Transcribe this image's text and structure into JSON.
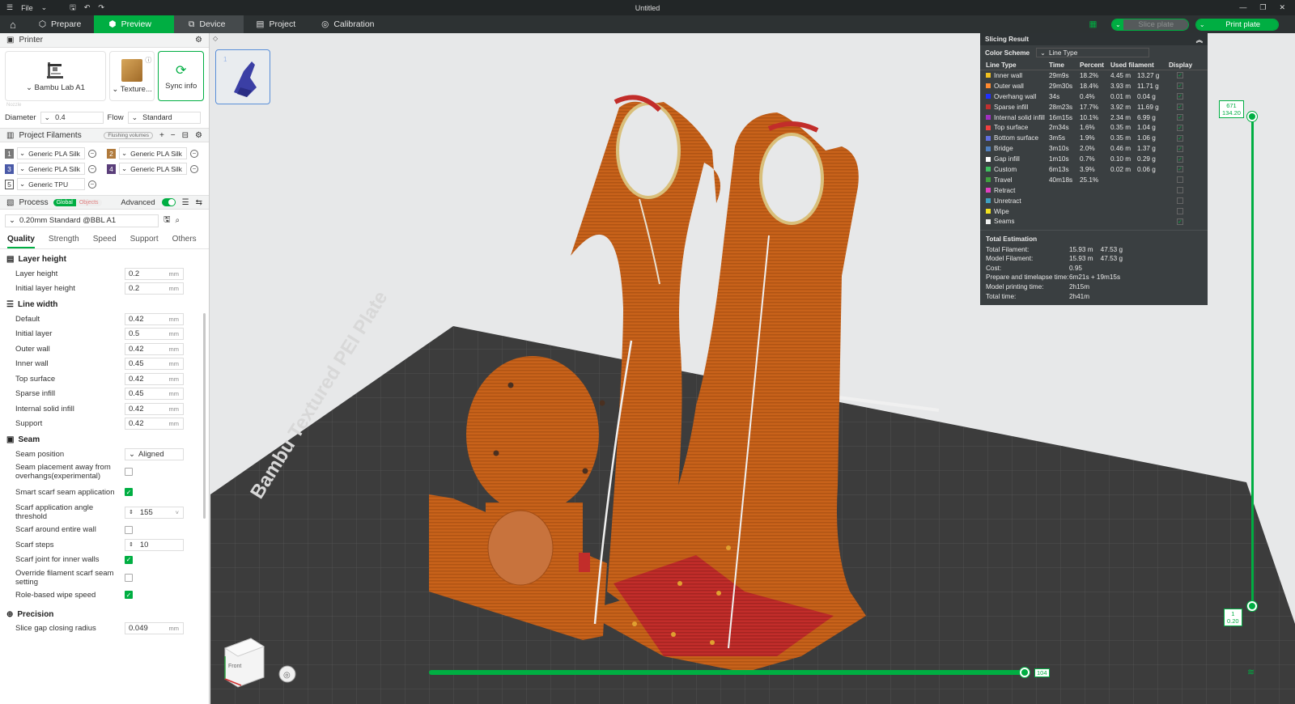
{
  "titlebar": {
    "file": "File",
    "title": "Untitled"
  },
  "tabs": {
    "prepare": "Prepare",
    "preview": "Preview",
    "device": "Device",
    "project": "Project",
    "calibration": "Calibration"
  },
  "actions": {
    "slice": "Slice plate",
    "print": "Print plate"
  },
  "printer": {
    "section": "Printer",
    "model": "Bambu Lab A1",
    "plate": "Texture...",
    "sync": "Sync info",
    "nozzle": "Nozzle",
    "diameter_label": "Diameter",
    "diameter": "0.4",
    "flow_label": "Flow",
    "flow": "Standard"
  },
  "filaments": {
    "section": "Project Filaments",
    "flushing": "Flushing volumes",
    "items": [
      {
        "num": "1",
        "name": "Generic PLA Silk",
        "color": "#7a7a7a"
      },
      {
        "num": "2",
        "name": "Generic PLA Silk",
        "color": "#b07a3c"
      },
      {
        "num": "3",
        "name": "Generic PLA Silk",
        "color": "#4a5aa8"
      },
      {
        "num": "4",
        "name": "Generic PLA Silk",
        "color": "#5a3e7a"
      },
      {
        "num": "5",
        "name": "Generic TPU",
        "color": "#ffffff"
      }
    ]
  },
  "process": {
    "section": "Process",
    "global": "Global",
    "objects": "Objects",
    "advanced": "Advanced",
    "preset": "0.20mm Standard @BBL A1",
    "tabs": [
      "Quality",
      "Strength",
      "Speed",
      "Support",
      "Others"
    ]
  },
  "params": {
    "layer_height": {
      "title": "Layer height",
      "rows": [
        {
          "label": "Layer height",
          "value": "0.2",
          "unit": "mm"
        },
        {
          "label": "Initial layer height",
          "value": "0.2",
          "unit": "mm"
        }
      ]
    },
    "line_width": {
      "title": "Line width",
      "rows": [
        {
          "label": "Default",
          "value": "0.42",
          "unit": "mm"
        },
        {
          "label": "Initial layer",
          "value": "0.5",
          "unit": "mm"
        },
        {
          "label": "Outer wall",
          "value": "0.42",
          "unit": "mm"
        },
        {
          "label": "Inner wall",
          "value": "0.45",
          "unit": "mm"
        },
        {
          "label": "Top surface",
          "value": "0.42",
          "unit": "mm"
        },
        {
          "label": "Sparse infill",
          "value": "0.45",
          "unit": "mm"
        },
        {
          "label": "Internal solid infill",
          "value": "0.42",
          "unit": "mm"
        },
        {
          "label": "Support",
          "value": "0.42",
          "unit": "mm"
        }
      ]
    },
    "seam": {
      "title": "Seam",
      "position_label": "Seam position",
      "position": "Aligned",
      "away_label": "Seam placement away from overhangs(experimental)",
      "smart_label": "Smart scarf seam application",
      "angle_label": "Scarf application angle threshold",
      "angle": "155",
      "around_label": "Scarf around entire wall",
      "steps_label": "Scarf steps",
      "steps": "10",
      "inner_label": "Scarf joint for inner walls",
      "override_label": "Override filament scarf seam setting",
      "role_label": "Role-based wipe speed"
    },
    "precision": {
      "title": "Precision",
      "gap_label": "Slice gap closing radius",
      "gap": "0.049",
      "unit": "mm"
    }
  },
  "viewport": {
    "plate_text": "Bambu Textured PEI Plate",
    "plate_number": "1",
    "cube_label": "Front",
    "v_top": "671",
    "v_top2": "134.20",
    "v_bottom": "1",
    "v_bottom2": "0.20",
    "h_right": "104"
  },
  "slicing": {
    "title": "Slicing Result",
    "scheme_label": "Color Scheme",
    "scheme": "Line Type",
    "headers": [
      "Line Type",
      "Time",
      "Percent",
      "Used filament",
      "Display"
    ],
    "rows": [
      {
        "name": "Inner wall",
        "time": "29m9s",
        "pct": "18.2%",
        "len": "4.45 m",
        "g": "13.27 g",
        "color": "#f0c020",
        "on": true
      },
      {
        "name": "Outer wall",
        "time": "29m30s",
        "pct": "18.4%",
        "len": "3.93 m",
        "g": "11.71 g",
        "color": "#ff8a30",
        "on": true
      },
      {
        "name": "Overhang wall",
        "time": "34s",
        "pct": "0.4%",
        "len": "0.01 m",
        "g": "0.04 g",
        "color": "#2030ff",
        "on": true
      },
      {
        "name": "Sparse infill",
        "time": "28m23s",
        "pct": "17.7%",
        "len": "3.92 m",
        "g": "11.69 g",
        "color": "#c03030",
        "on": true
      },
      {
        "name": "Internal solid infill",
        "time": "16m15s",
        "pct": "10.1%",
        "len": "2.34 m",
        "g": "6.99 g",
        "color": "#a030c0",
        "on": true
      },
      {
        "name": "Top surface",
        "time": "2m34s",
        "pct": "1.6%",
        "len": "0.35 m",
        "g": "1.04 g",
        "color": "#f04040",
        "on": true
      },
      {
        "name": "Bottom surface",
        "time": "3m5s",
        "pct": "1.9%",
        "len": "0.35 m",
        "g": "1.06 g",
        "color": "#6070e0",
        "on": true
      },
      {
        "name": "Bridge",
        "time": "3m10s",
        "pct": "2.0%",
        "len": "0.46 m",
        "g": "1.37 g",
        "color": "#5080c0",
        "on": true
      },
      {
        "name": "Gap infill",
        "time": "1m10s",
        "pct": "0.7%",
        "len": "0.10 m",
        "g": "0.29 g",
        "color": "#ffffff",
        "on": true
      },
      {
        "name": "Custom",
        "time": "6m13s",
        "pct": "3.9%",
        "len": "0.02 m",
        "g": "0.06 g",
        "color": "#40c060",
        "on": true
      },
      {
        "name": "Travel",
        "time": "40m18s",
        "pct": "25.1%",
        "len": "",
        "g": "",
        "color": "#40a040",
        "on": false
      },
      {
        "name": "Retract",
        "time": "",
        "pct": "",
        "len": "",
        "g": "",
        "color": "#e040c0",
        "on": false
      },
      {
        "name": "Unretract",
        "time": "",
        "pct": "",
        "len": "",
        "g": "",
        "color": "#40a0c0",
        "on": false
      },
      {
        "name": "Wipe",
        "time": "",
        "pct": "",
        "len": "",
        "g": "",
        "color": "#f0e020",
        "on": false
      },
      {
        "name": "Seams",
        "time": "",
        "pct": "",
        "len": "",
        "g": "",
        "color": "#f0f0f0",
        "on": true
      }
    ],
    "total_title": "Total Estimation",
    "totals": [
      {
        "k": "Total Filament:",
        "v": "15.93 m    47.53 g"
      },
      {
        "k": "Model Filament:",
        "v": "15.93 m    47.53 g"
      },
      {
        "k": "Cost:",
        "v": "0.95"
      },
      {
        "k": "Prepare and timelapse time:",
        "v": "6m21s + 19m15s"
      },
      {
        "k": "Model printing time:",
        "v": "2h15m"
      },
      {
        "k": "Total time:",
        "v": "2h41m"
      }
    ]
  }
}
